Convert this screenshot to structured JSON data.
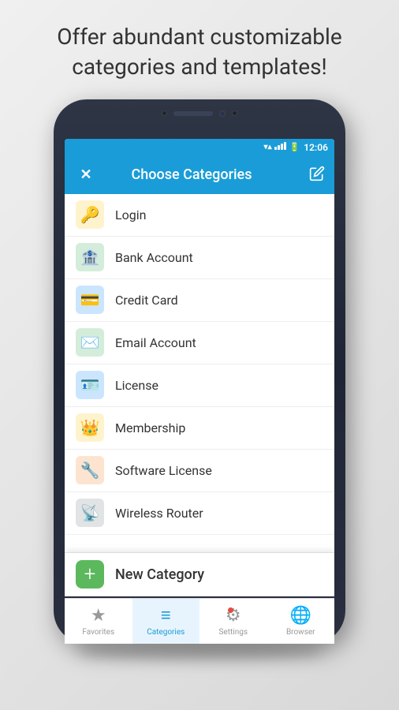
{
  "tagline": "Offer abundant customizable categories and templates!",
  "header": {
    "title": "Choose Categories",
    "close_label": "✕",
    "edit_label": "✏"
  },
  "status": {
    "time": "12:06"
  },
  "categories": [
    {
      "id": "login",
      "label": "Login",
      "icon": "🔑",
      "icon_class": "icon-login"
    },
    {
      "id": "bank",
      "label": "Bank Account",
      "icon": "🏦",
      "icon_class": "icon-bank"
    },
    {
      "id": "credit",
      "label": "Credit Card",
      "icon": "💳",
      "icon_class": "icon-credit"
    },
    {
      "id": "email",
      "label": "Email Account",
      "icon": "✉",
      "icon_class": "icon-email"
    },
    {
      "id": "license",
      "label": "License",
      "icon": "🪪",
      "icon_class": "icon-license"
    },
    {
      "id": "membership",
      "label": "Membership",
      "icon": "👑",
      "icon_class": "icon-membership"
    },
    {
      "id": "software",
      "label": "Software License",
      "icon": "🔧",
      "icon_class": "icon-software"
    },
    {
      "id": "wireless",
      "label": "Wireless Router",
      "icon": "📡",
      "icon_class": "icon-wireless"
    }
  ],
  "new_category": {
    "label": "New Category",
    "plus": "+"
  },
  "bottom_nav": [
    {
      "id": "favorites",
      "label": "Favorites",
      "icon": "★",
      "active": false
    },
    {
      "id": "categories",
      "label": "Categories",
      "icon": "☰",
      "active": true
    },
    {
      "id": "settings",
      "label": "Settings",
      "icon": "⚙",
      "active": false,
      "has_dot": true
    },
    {
      "id": "browser",
      "label": "Browser",
      "icon": "🌐",
      "active": false
    }
  ]
}
